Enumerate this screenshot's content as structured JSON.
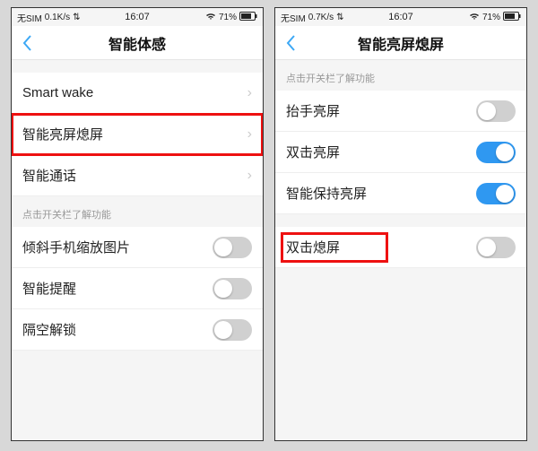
{
  "left": {
    "status": {
      "carrier": "无SIM",
      "speed": "0.1K/s",
      "time": "16:07",
      "battery": "71%"
    },
    "title": "智能体感",
    "group1": {
      "items": [
        {
          "label": "Smart wake",
          "type": "nav"
        },
        {
          "label": "智能亮屏熄屏",
          "type": "nav",
          "highlight": true
        },
        {
          "label": "智能通话",
          "type": "nav"
        }
      ]
    },
    "group2": {
      "hint": "点击开关栏了解功能",
      "items": [
        {
          "label": "倾斜手机缩放图片",
          "type": "toggle",
          "on": false
        },
        {
          "label": "智能提醒",
          "type": "toggle",
          "on": false
        },
        {
          "label": "隔空解锁",
          "type": "toggle",
          "on": false
        }
      ]
    }
  },
  "right": {
    "status": {
      "carrier": "无SIM",
      "speed": "0.7K/s",
      "time": "16:07",
      "battery": "71%"
    },
    "title": "智能亮屏熄屏",
    "group1": {
      "hint": "点击开关栏了解功能",
      "items": [
        {
          "label": "抬手亮屏",
          "type": "toggle",
          "on": false
        },
        {
          "label": "双击亮屏",
          "type": "toggle",
          "on": true
        },
        {
          "label": "智能保持亮屏",
          "type": "toggle",
          "on": true
        }
      ]
    },
    "group2": {
      "items": [
        {
          "label": "双击熄屏",
          "type": "toggle",
          "on": false,
          "highlight": true
        }
      ]
    }
  }
}
